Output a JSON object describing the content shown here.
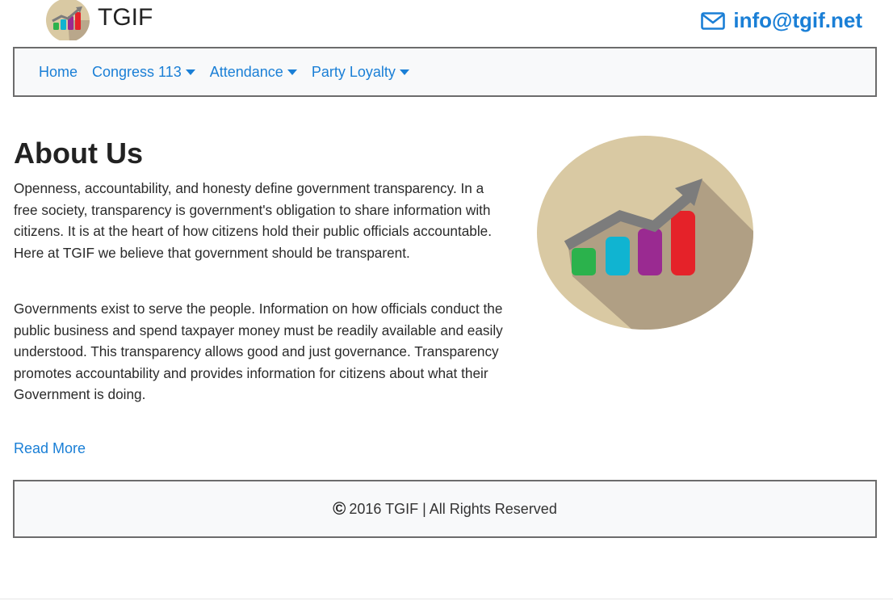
{
  "header": {
    "brand": "TGIF",
    "email": "info@tgif.net",
    "logo_icon": "chart-growth-logo-icon",
    "email_icon": "envelope-icon"
  },
  "nav": {
    "items": [
      {
        "label": "Home",
        "dropdown": false
      },
      {
        "label": "Congress 113",
        "dropdown": true
      },
      {
        "label": "Attendance",
        "dropdown": true
      },
      {
        "label": "Party Loyalty",
        "dropdown": true
      }
    ]
  },
  "main": {
    "title": "About Us",
    "paragraphs": [
      "Openness, accountability, and honesty define government transparency. In a free society, transparency is government's obligation to share information with citizens. It is at the heart of how citizens hold their public officials accountable. Here at TGIF we believe that government should be transparent.",
      "Governments exist to serve the people. Information on how officials conduct the public business and spend taxpayer money must be readily available and easily understood. This transparency allows good and just governance. Transparency promotes accountability and provides information for citizens about what their Government is doing."
    ],
    "read_more": "Read More",
    "hero_icon": "growth-chart-illustration"
  },
  "footer": {
    "copyright_symbol": "©",
    "text": "2016 TGIF | All Rights Reserved"
  },
  "colors": {
    "link": "#1a7fd6",
    "bar_green": "#2bb24c",
    "bar_cyan": "#10b4d1",
    "bar_purple": "#9a2a91",
    "bar_red": "#e52229",
    "circle": "#d9c9a3",
    "shadow": "#b09f84",
    "arrow": "#7c7c7c"
  }
}
